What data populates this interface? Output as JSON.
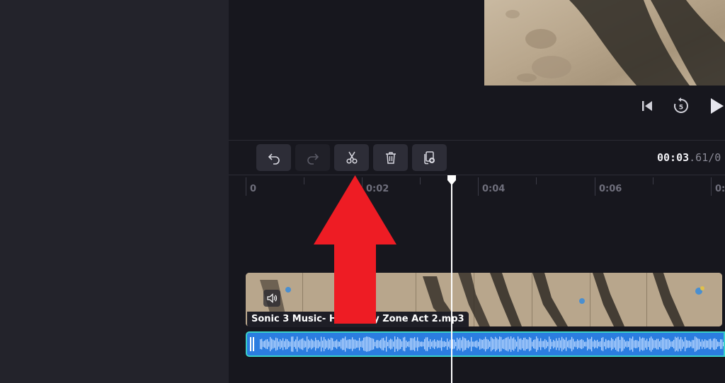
{
  "toolbar": {
    "undo_icon": "undo-icon",
    "redo_icon": "redo-icon",
    "split_icon": "scissors-icon",
    "delete_icon": "trash-icon",
    "duplicate_icon": "duplicate-icon"
  },
  "playback": {
    "skip_back_icon": "skip-back-icon",
    "rewind_icon": "rewind-5-icon",
    "rewind_label": "5",
    "play_icon": "play-icon"
  },
  "timecode": {
    "current_main": "00:03",
    "current_frac": ".61",
    "separator": "/",
    "total_start": "0"
  },
  "ruler": {
    "labels": [
      "0",
      "0:02",
      "0:04",
      "0:06",
      "0:"
    ]
  },
  "timeline": {
    "audio_clip_name": "Sonic 3 Music- Hydrocity Zone Act 2.mp3"
  },
  "colors": {
    "audio_clip": "#2b7de0",
    "audio_border": "#3ad0c8",
    "annotation_arrow": "#ee1c24",
    "playhead": "#ffffff"
  }
}
